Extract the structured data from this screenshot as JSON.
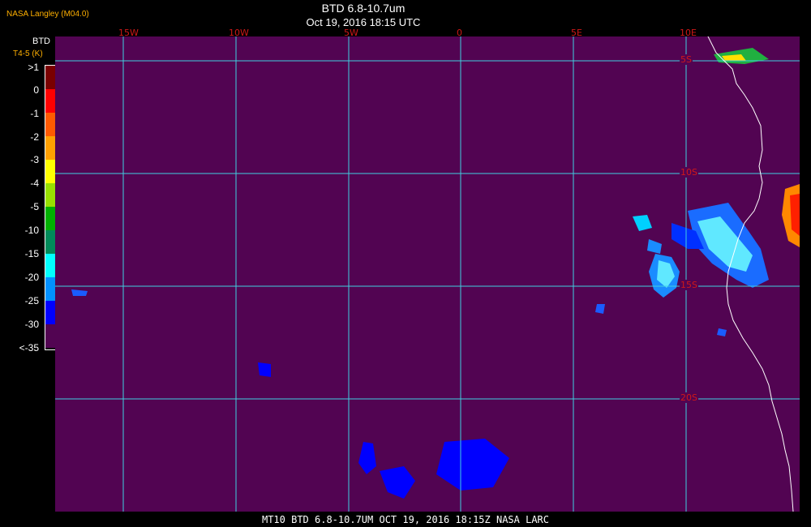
{
  "header": {
    "credit": "NASA Langley (M04.0)",
    "title": "BTD 6.8-10.7um",
    "datetime": "Oct 19, 2016 18:15 UTC"
  },
  "legend": {
    "title": "BTD",
    "subtitle": "T4-5 (K)",
    "ticks": [
      ">1",
      "0",
      "-1",
      "-2",
      "-3",
      "-4",
      "-5",
      "-10",
      "-15",
      "-20",
      "-25",
      "-30",
      "<-35"
    ],
    "colors": [
      "#7a0000",
      "#ff0000",
      "#ff5a00",
      "#ffa000",
      "#ffff00",
      "#98e000",
      "#00b000",
      "#008a5a",
      "#00ffff",
      "#0090ff",
      "#0000ff",
      "#520452"
    ]
  },
  "grid": {
    "longitudes": [
      "15W",
      "10W",
      "5W",
      "0",
      "5E",
      "10E"
    ],
    "latitudes": [
      "5S",
      "10S",
      "15S",
      "20S"
    ]
  },
  "footer": "MT10  BTD 6.8-10.7UM  OCT 19, 2016 18:15Z  NASA LARC",
  "colors": {
    "background": "#520452",
    "gridlines": "#40d0e0",
    "grid_labels": "#d01818",
    "coastline": "#ffffff"
  }
}
